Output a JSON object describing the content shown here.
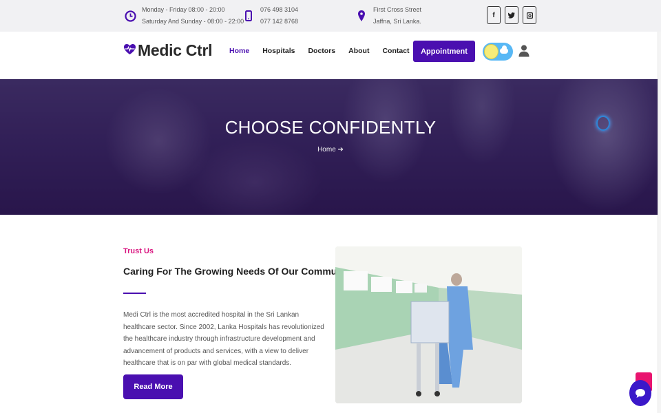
{
  "topbar": {
    "hours_line1": "Monday - Friday 08:00 - 20:00",
    "hours_line2": "Saturday And Sunday - 08:00 - 22:00",
    "phone_line1": "076 498 3104",
    "phone_line2": "077 142 8768",
    "address_line1": "First Cross Street",
    "address_line2": "Jaffna, Sri Lanka.",
    "social": [
      "f",
      "🐦",
      "▣"
    ]
  },
  "nav": {
    "brand": "Medic Ctrl",
    "items": [
      "Home",
      "Hospitals",
      "Doctors",
      "About",
      "Contact"
    ],
    "appointment_label": "Appointment"
  },
  "hero": {
    "title": "CHOOSE CONFIDENTLY",
    "breadcrumb": "Home ➔"
  },
  "about": {
    "eyebrow": "Trust Us",
    "heading": "Caring For The Growing Needs Of Our Community.",
    "body": "Medi Ctrl is the most accredited hospital in the Sri Lankan healthcare sector. Since 2002, Lanka Hospitals has revolutionized the healthcare industry through infrastructure development and advancement of products and services, with a view to deliver healthcare that is on par with global medical standards.",
    "button_label": "Read More"
  },
  "colors": {
    "brand": "#4a0fb0",
    "accent": "#d9147f",
    "chat": "#3b18c9"
  },
  "icons": [
    "clock-icon",
    "phone-icon",
    "location-pin-icon",
    "facebook-icon",
    "twitter-icon",
    "instagram-icon",
    "heartbeat-icon",
    "user-icon",
    "chat-icon",
    "arrow-up-icon"
  ]
}
